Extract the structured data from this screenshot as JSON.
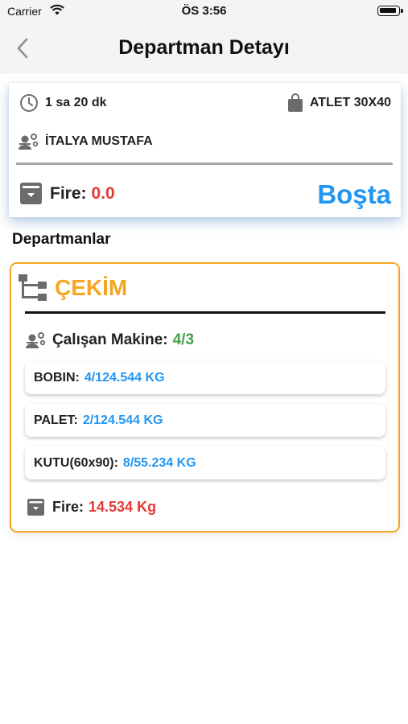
{
  "status_bar": {
    "carrier": "Carrier",
    "time": "ÖS 3:56"
  },
  "nav": {
    "title": "Departman Detayı"
  },
  "summary": {
    "duration": "1 sa 20 dk",
    "product": "ATLET 30X40",
    "operator": "İTALYA MUSTAFA",
    "fire_label": "Fire:",
    "fire_value": "0.0",
    "status": "Boşta"
  },
  "section_title": "Departmanlar",
  "department": {
    "name": "ÇEKİM",
    "machine_label": "Çalışan Makine:",
    "machine_value": "4/3",
    "materials": [
      {
        "name": "BOBIN:",
        "value": "4/124.544 KG"
      },
      {
        "name": "PALET:",
        "value": "2/124.544 KG"
      },
      {
        "name": "KUTU(60x90):",
        "value": "8/55.234 KG"
      }
    ],
    "fire_label": "Fire:",
    "fire_value": "14.534 Kg"
  },
  "colors": {
    "accent_blue": "#2196f3",
    "accent_orange": "#f5a623",
    "fire_red": "#e53935",
    "machine_green": "#43a047"
  },
  "icons": {
    "duration": "clock-icon",
    "product": "shopping-bag-icon",
    "operator": "worker-gear-icon",
    "fire": "archive-box-icon",
    "department": "flow-diagram-icon",
    "back": "chevron-left-icon"
  }
}
